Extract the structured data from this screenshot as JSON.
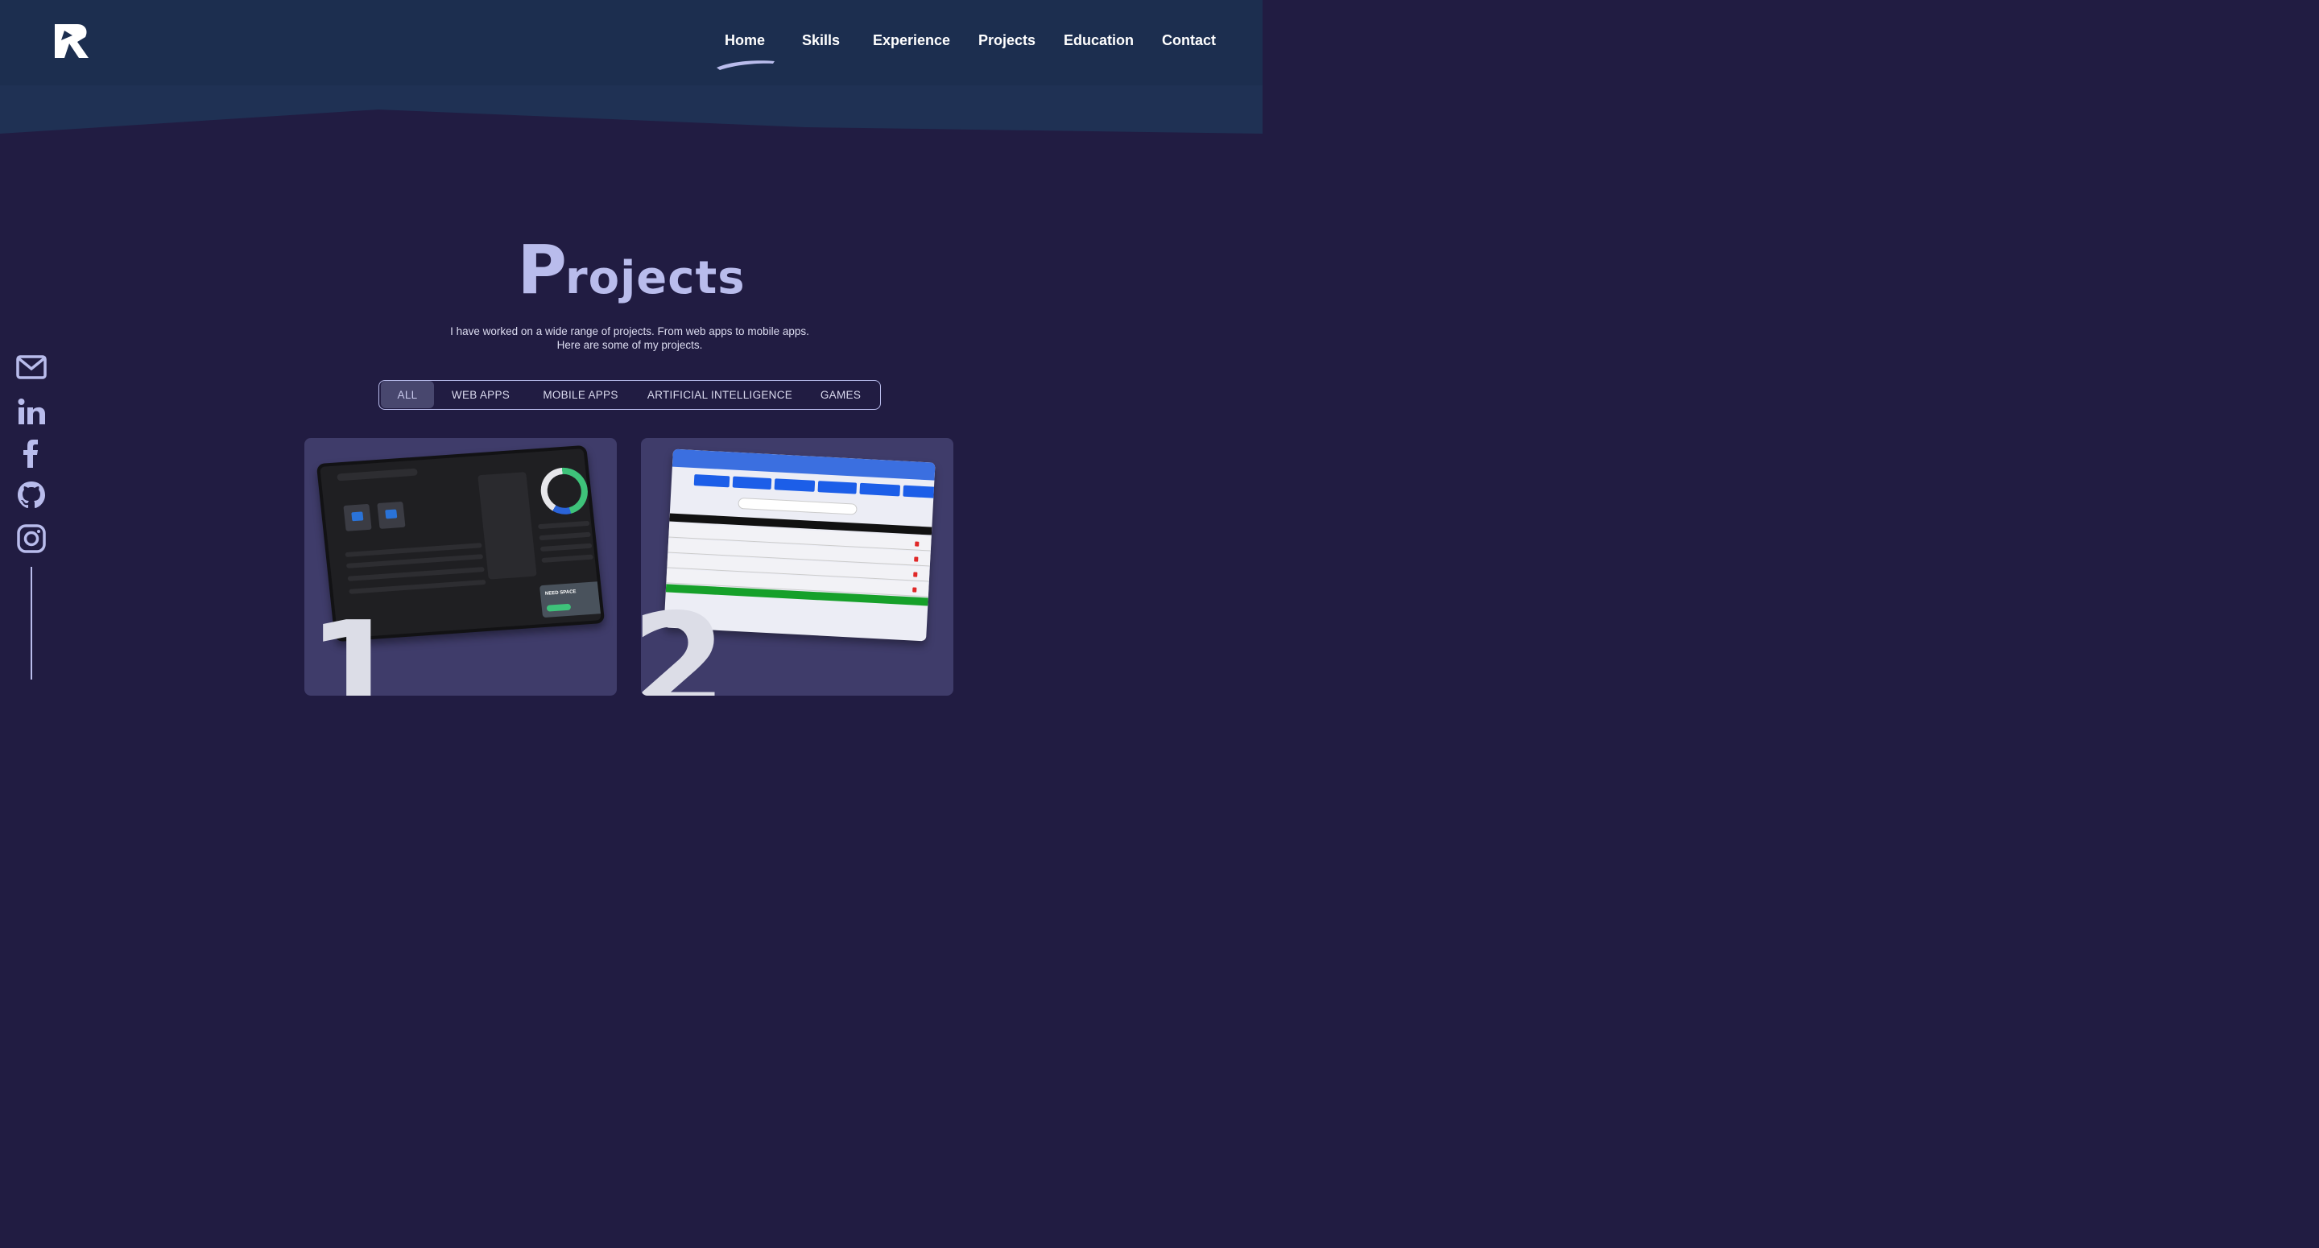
{
  "header": {
    "logo": "R-logo",
    "nav": [
      {
        "label": "Home",
        "active": true
      },
      {
        "label": "Skills"
      },
      {
        "label": "Experience"
      },
      {
        "label": "Projects"
      },
      {
        "label": "Education"
      },
      {
        "label": "Contact"
      }
    ]
  },
  "projects": {
    "title_first": "P",
    "title_rest": "rojects",
    "subtitle_line1": "I have worked on a wide range of projects. From web apps to mobile apps.",
    "subtitle_line2": "Here are some of my projects.",
    "filters": [
      {
        "label": "ALL",
        "active": true
      },
      {
        "label": "WEB APPS"
      },
      {
        "label": "MOBILE APPS"
      },
      {
        "label": "ARTIFICIAL INTELLIGENCE"
      },
      {
        "label": "GAMES"
      }
    ],
    "cards": [
      {
        "number": "1",
        "preview": "storage-dashboard"
      },
      {
        "number": "2",
        "preview": "fridge-inventory"
      }
    ]
  },
  "social": [
    "mail-icon",
    "linkedin-icon",
    "facebook-icon",
    "github-icon",
    "instagram-icon"
  ],
  "colors": {
    "background": "#211c42",
    "header": "#1c2e4f",
    "accent": "#b9bcec",
    "card": "#3f3c6a"
  }
}
